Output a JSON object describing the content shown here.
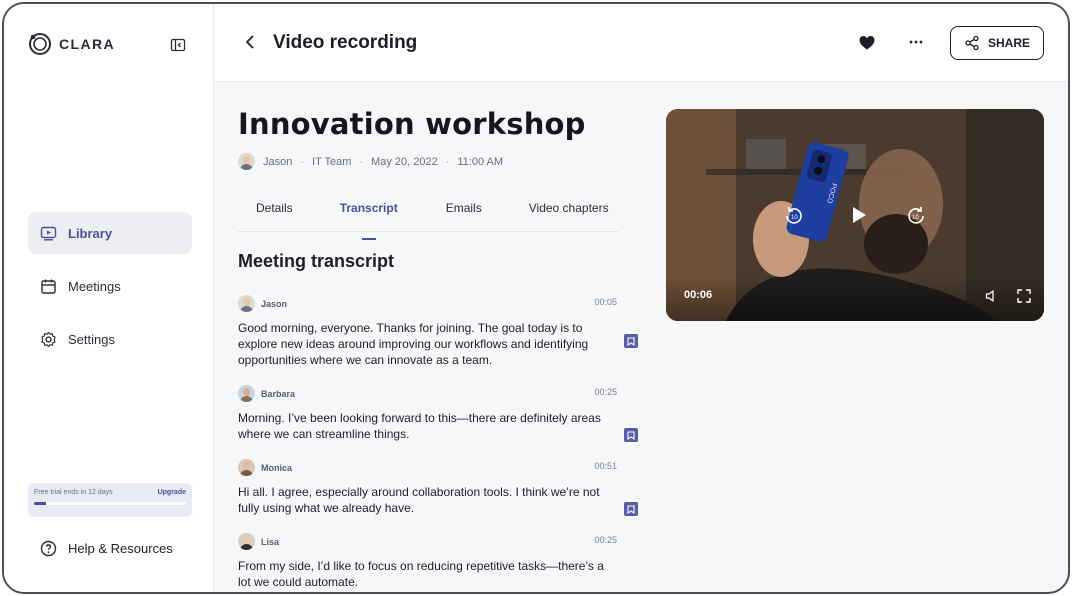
{
  "sidebar": {
    "logo_text": "CLARA",
    "nav": [
      {
        "label": "Library",
        "icon": "play-square-icon",
        "active": true
      },
      {
        "label": "Meetings",
        "icon": "calendar-icon",
        "active": false
      },
      {
        "label": "Settings",
        "icon": "gear-icon",
        "active": false
      }
    ],
    "trial": {
      "text": "Free trial ends in 12 days",
      "link": "Upgrade",
      "progress": 0.08
    },
    "help_label": "Help & Resources"
  },
  "header": {
    "title": "Video recording",
    "share_label": "SHARE",
    "icons": [
      "chevron-left-icon",
      "heart-icon",
      "more-icon",
      "share-icon"
    ]
  },
  "meeting": {
    "title": "Innovation workshop",
    "meta": {
      "host": "Jason",
      "team": "IT Team",
      "date": "May 20, 2022",
      "time": "11:00 AM"
    },
    "tabs": [
      {
        "label": "Details",
        "active": false
      },
      {
        "label": "Transcript",
        "active": true
      },
      {
        "label": "Emails",
        "active": false
      },
      {
        "label": "Video chapters",
        "active": false
      }
    ]
  },
  "transcript": {
    "heading": "Meeting transcript",
    "entries": [
      {
        "speaker": "Jason",
        "time": "00:05",
        "text": "Good morning, everyone. Thanks for joining. The goal today is to explore new ideas around improving our workflows and identifying opportunities where we can innovate as a team."
      },
      {
        "speaker": "Barbara",
        "time": "00:25",
        "text": "Morning. I’ve been looking forward to this—there are definitely areas where we can streamline things."
      },
      {
        "speaker": "Monica",
        "time": "00:51",
        "text": "Hi all. I agree, especially around collaboration tools. I think we’re not fully using what we already have."
      },
      {
        "speaker": "Lisa",
        "time": "00:25",
        "text": "From my side, I’d like to focus on reducing repetitive tasks—there’s a lot we could automate."
      }
    ]
  },
  "video": {
    "current_time": "00:06",
    "phone_brand": "POCO",
    "icons": [
      "rewind-10-icon",
      "play-icon",
      "forward-10-icon",
      "volume-icon",
      "fullscreen-icon"
    ]
  },
  "colors": {
    "accent": "#4a4f9a",
    "active_bg": "#eceef2",
    "bookmark": "#5a5ea7"
  }
}
